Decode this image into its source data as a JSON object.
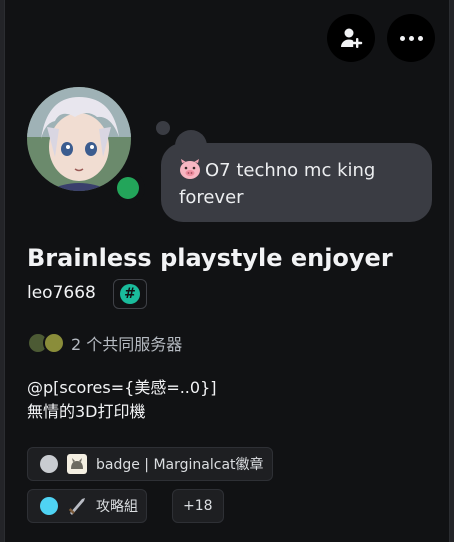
{
  "colors": {
    "card_bg": "#111214",
    "status_online": "#23a55a",
    "bubble_bg": "#3a3c43",
    "role1_dot": "#c9ccd1",
    "role2_dot": "#4fd3f3",
    "hash_badge": "#1abc9c"
  },
  "header": {
    "add_friend_icon": "add-friend-icon",
    "more_icon": "more-icon"
  },
  "profile": {
    "status_message": "O7 techno mc king forever",
    "status_emoji": "pig-face-emoji",
    "display_name": "Brainless playstyle enjoyer",
    "username": "leo7668",
    "badge_symbol": "#",
    "mutual_servers": "2 个共同服务器",
    "bio_line1": "@p[scores={美感=..0}]",
    "bio_line2": "無情的3D打印機"
  },
  "roles": [
    {
      "name": "badge | Marginalcat徽章"
    },
    {
      "name": "攻略組"
    }
  ],
  "roles_more": "+18"
}
